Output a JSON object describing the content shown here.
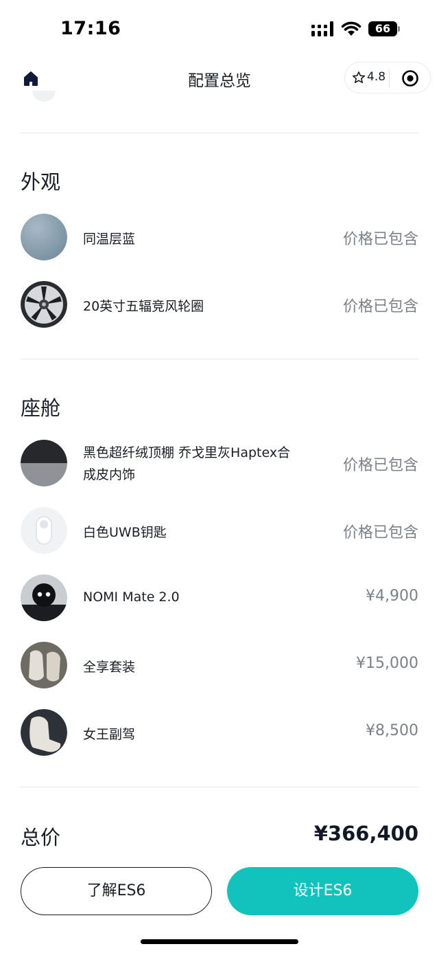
{
  "status_bar": {
    "time": "17:16",
    "battery": "66",
    "icons": [
      "signal-icon",
      "wifi-icon",
      "battery-icon"
    ]
  },
  "nav": {
    "title": "配置总览",
    "rating": "4.8",
    "icons": [
      "home-icon",
      "star-icon",
      "target-icon"
    ]
  },
  "exterior": {
    "title": "外观",
    "items": [
      {
        "name": "同温层蓝",
        "price": "价格已包含"
      },
      {
        "name": "20英寸五辐竞风轮圈",
        "price": "价格已包含"
      }
    ]
  },
  "cabin": {
    "title": "座舱",
    "items": [
      {
        "name": "黑色超纤绒顶棚 乔戈里灰Haptex合成皮内饰",
        "price": "价格已包含"
      },
      {
        "name": "白色UWB钥匙",
        "price": "价格已包含"
      },
      {
        "name": "NOMI Mate 2.0",
        "price": "¥4,900"
      },
      {
        "name": "全享套装",
        "price": "¥15,000"
      },
      {
        "name": "女王副驾",
        "price": "¥8,500"
      }
    ]
  },
  "total": {
    "label": "总价",
    "value": "¥366,400"
  },
  "actions": {
    "learn_label": "了解ES6",
    "design_label": "设计ES6"
  },
  "colors": {
    "accent": "#12c2bd",
    "text": "#1a1d24",
    "muted": "#7b8089",
    "paint_blue": "#8aa0b0"
  }
}
